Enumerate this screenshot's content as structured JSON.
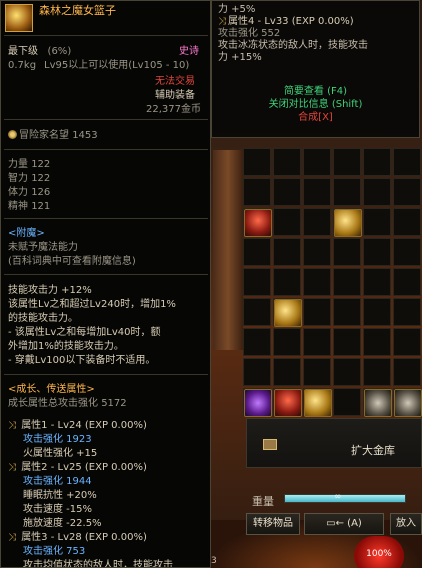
{
  "item": {
    "name": "森林之魔女篮子",
    "min_level_label": "最下级",
    "min_level_pct": "(6%)",
    "rarity": "史诗",
    "weight": "0.7kg",
    "level_req": "Lv95以上可以使用(Lv105 - 10)",
    "trade": "无法交易",
    "equip_type": "辅助装备",
    "price": "22,377金币"
  },
  "adventurer": {
    "label": "冒险家名望",
    "value": "1453"
  },
  "stats": [
    {
      "name": "力量",
      "value": "122"
    },
    {
      "name": "智力",
      "value": "122"
    },
    {
      "name": "体力",
      "value": "126"
    },
    {
      "name": "精神",
      "value": "121"
    }
  ],
  "enchant": {
    "header": "<附魔>",
    "line1": "未赋予魔法能力",
    "line2": "(百科词典中可查看附魔信息)"
  },
  "skill": {
    "lines": [
      "技能攻击力 +12%",
      "该属性Lv之和超过Lv240时，增加1%",
      "的技能攻击力。",
      "- 该属性Lv之和每增加Lv40时，额",
      "外增加1%的技能攻击力。",
      "- 穿戴Lv100以下装备时不适用。"
    ]
  },
  "growth": {
    "header": "<成长、传送属性>",
    "total_label": "成长属性总攻击强化",
    "total_value": "5172",
    "attrs": [
      {
        "title": "属性1 - Lv24 (EXP 0.00%)",
        "lines": [
          "攻击强化 1923",
          "火属性强化 +15"
        ]
      },
      {
        "title": "属性2 - Lv25 (EXP 0.00%)",
        "lines": [
          "攻击强化 1944",
          "睡眠抗性 +20%",
          "攻击速度 -15%",
          "施放速度 -22.5%"
        ]
      },
      {
        "title": "属性3 - Lv28 (EXP 0.00%)",
        "lines": [
          "攻击强化 753",
          "攻击均值状态的敌人时，技能攻击"
        ]
      }
    ]
  },
  "right_tooltip": {
    "line0": "力 +5%",
    "attr4_title": "属性4 - Lv33 (EXP 0.00%)",
    "attr4_atk": "攻击强化 552",
    "attr4_desc1": "攻击冰冻状态的敌人时，技能攻击",
    "attr4_desc2": "力 +15%",
    "brief_view": "简要查看 (F4)",
    "close_compare": "关闭对比信息 (Shift)",
    "synth": "合成[X]"
  },
  "storage": {
    "expand_label": "扩大金库",
    "weight_label": "重量",
    "weight_fill": 1.0,
    "weight_value": "∞",
    "transfer_label": "转移物品",
    "arrange_label": "← (A)",
    "deposit_label": "放入"
  },
  "hud": {
    "hp_text": "100%",
    "num": "3"
  },
  "colors": {
    "rarity_epic": "#ff7ad0",
    "item_name": "#ffb64a",
    "no_trade": "#e0463a",
    "link_green": "#3fd27a"
  }
}
